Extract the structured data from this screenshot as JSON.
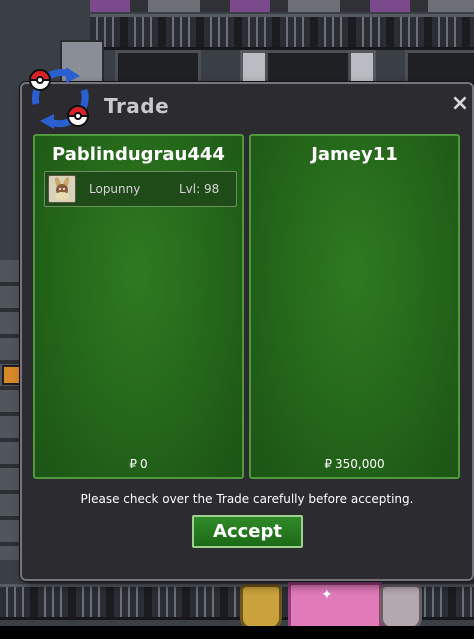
{
  "window": {
    "title": "Trade",
    "close_label": "×"
  },
  "players": [
    {
      "name": "Pablindugrau444",
      "money_symbol": "₽",
      "money": "0",
      "pokemon": [
        {
          "name": "Lopunny",
          "level": "Lvl: 98"
        }
      ]
    },
    {
      "name": "Jamey11",
      "money_symbol": "₽",
      "money": "350,000",
      "pokemon": []
    }
  ],
  "instruction": "Please check over the Trade carefully before accepting.",
  "accept_label": "Accept",
  "icons": {
    "logo": "trade-swap-pokeball-icon",
    "close": "close-icon",
    "pokemon": "lopunny-sprite-icon"
  },
  "colors": {
    "panel_green": "#24661a",
    "panel_border": "#4f9a3a",
    "window_bg": "#2c2b30",
    "accent_blue": "#2a5fd0",
    "pokeball_red": "#d8232a"
  }
}
